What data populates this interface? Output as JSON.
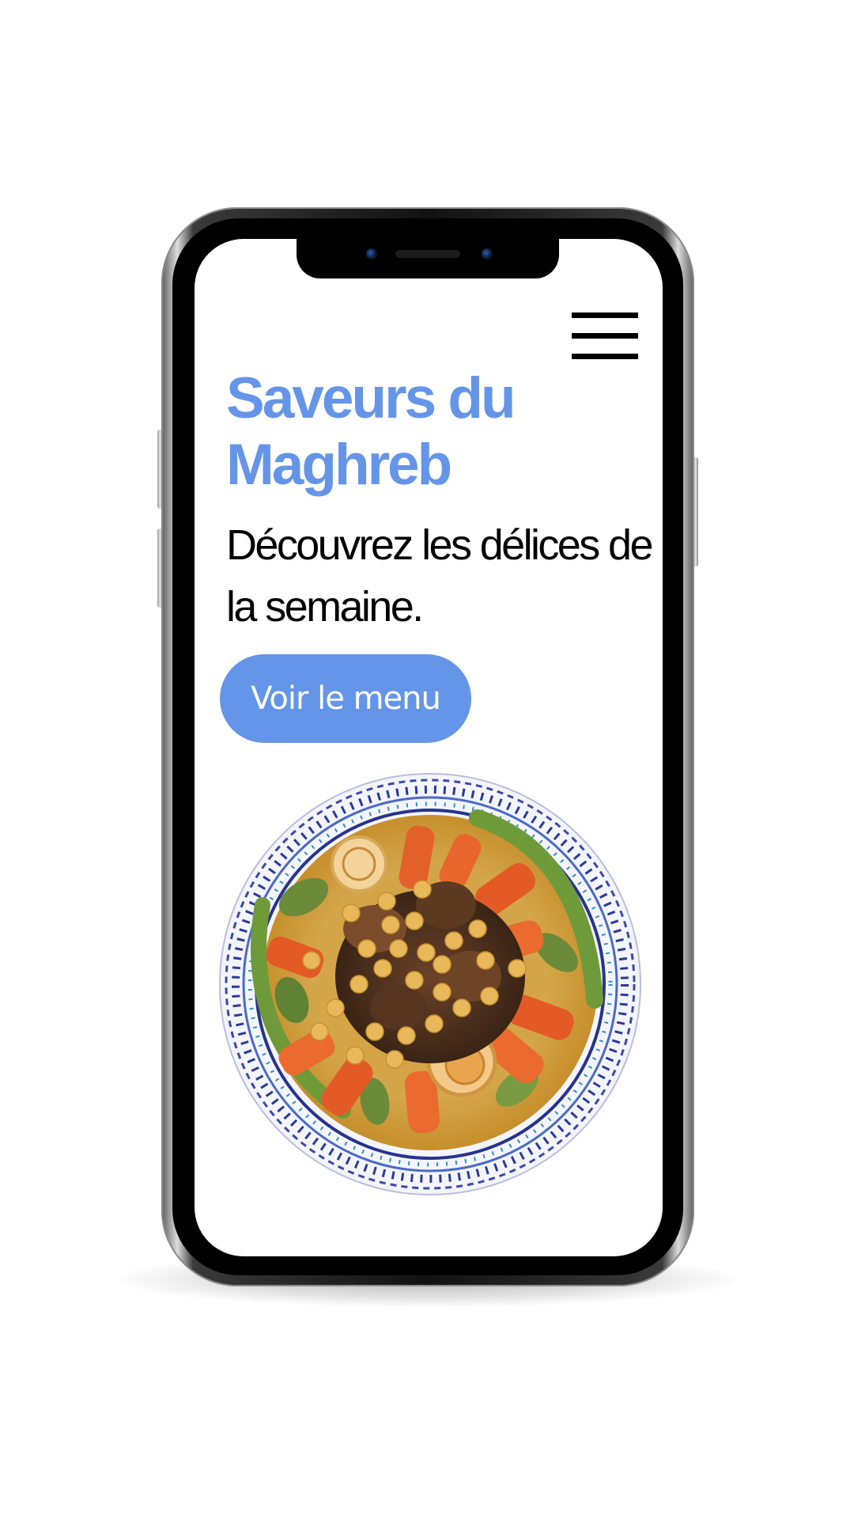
{
  "site": {
    "title": "Saveurs du Maghreb",
    "tagline": "Découvrez les délices de la semaine.",
    "cta_label": "Voir le menu"
  },
  "icons": {
    "menu": "hamburger-menu-icon",
    "hero_image": "couscous-plate"
  },
  "colors": {
    "accent": "#6595e8",
    "text": "#000000",
    "background": "#ffffff",
    "button_text": "#ffffff"
  }
}
